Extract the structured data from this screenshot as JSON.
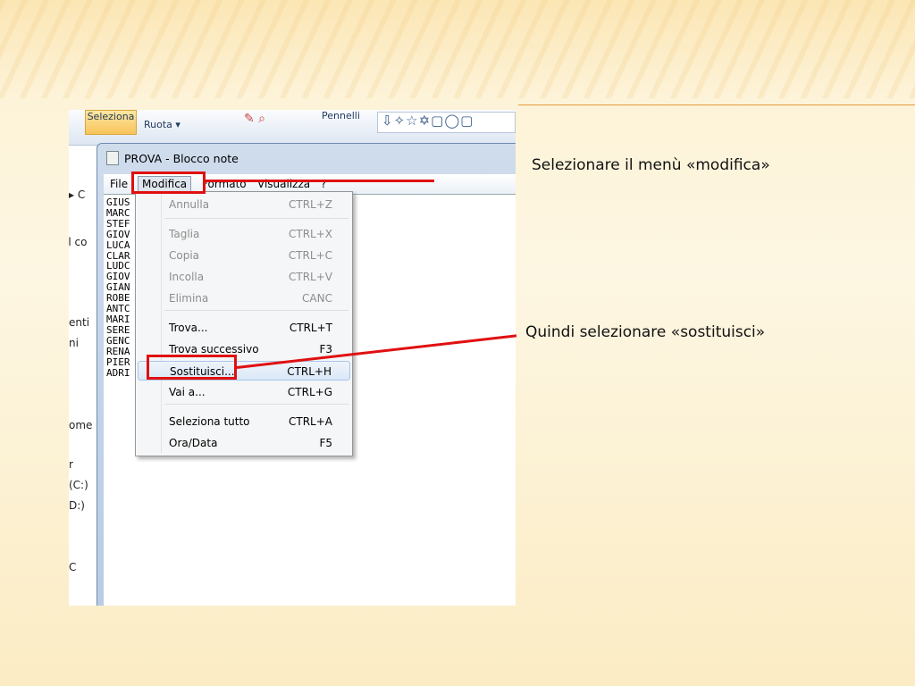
{
  "slide": {
    "caption1": "Selezionare il menù «modifica»",
    "caption2": "Quindi selezionare «sostituisci»"
  },
  "paint": {
    "select": "Seleziona",
    "rotate": "Ruota ▾",
    "brushes": "Pennelli",
    "shapes": "⇩✧☆✡▢◯▢"
  },
  "explorer": [
    "▸ C",
    "il co",
    "enti",
    "ni",
    "ome",
    "r",
    "(C:)",
    "D:)",
    "C"
  ],
  "notepad": {
    "title": "PROVA - Blocco note",
    "menu": [
      "File",
      "Modifica",
      "Formato",
      "Visualizza",
      "?"
    ],
    "lines": [
      "GIUS",
      "MARC",
      "STEF",
      "GIOV",
      "LUCA",
      "CLAR",
      "LUDC",
      "GIOV",
      "GIAN",
      "ROBE",
      "ANTC",
      "MARI",
      "SERE",
      "GENC",
      "RENA",
      "PIER",
      "ADRI"
    ]
  },
  "edit_menu": [
    {
      "label": "Annulla",
      "key": "CTRL+Z"
    },
    {
      "label": "Taglia",
      "key": "CTRL+X"
    },
    {
      "label": "Copia",
      "key": "CTRL+C"
    },
    {
      "label": "Incolla",
      "key": "CTRL+V"
    },
    {
      "label": "Elimina",
      "key": "CANC"
    },
    {
      "label": "Trova...",
      "key": "CTRL+T"
    },
    {
      "label": "Trova successivo",
      "key": "F3"
    },
    {
      "label": "Sostituisci...",
      "key": "CTRL+H"
    },
    {
      "label": "Vai a...",
      "key": "CTRL+G"
    },
    {
      "label": "Seleziona tutto",
      "key": "CTRL+A"
    },
    {
      "label": "Ora/Data",
      "key": "F5"
    }
  ]
}
